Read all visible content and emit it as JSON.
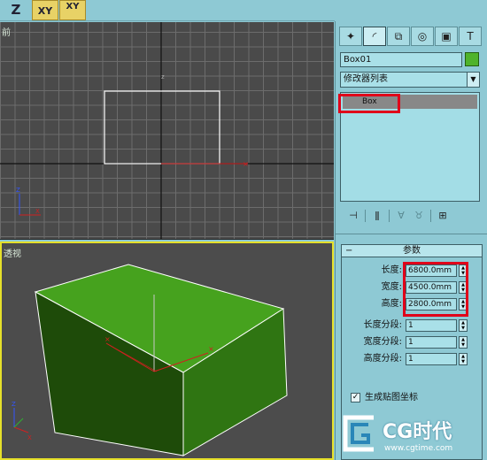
{
  "toolbar": {
    "axis_z": "Z",
    "axis_xy": "XY",
    "axis_xy_lock": "XY"
  },
  "viewports": {
    "front_label": "前",
    "perspective_label": "透视"
  },
  "command_panel": {
    "tabs": [
      "create-icon",
      "modify-icon",
      "hierarchy-icon",
      "motion-icon",
      "display-icon",
      "utilities-icon"
    ],
    "object_name": "Box01",
    "object_color": "#4fb32b",
    "modifier_list": "修改器列表",
    "stack_item": "Box"
  },
  "parameters": {
    "title": "参数",
    "length_label": "长度:",
    "length_value": "6800.0mm",
    "width_label": "宽度:",
    "width_value": "4500.0mm",
    "height_label": "高度:",
    "height_value": "2800.0mm",
    "length_segs_label": "长度分段:",
    "length_segs_value": "1",
    "width_segs_label": "宽度分段:",
    "width_segs_value": "1",
    "height_segs_label": "高度分段:",
    "height_segs_value": "1",
    "gen_map_label": "生成贴图坐标",
    "gen_map_checked": true
  },
  "watermark": {
    "brand": "CG时代",
    "url": "www.cgtime.com"
  },
  "colors": {
    "highlight": "#e0001a",
    "box_green": "#4fb32b",
    "active_viewport_border": "#e6e02a"
  }
}
